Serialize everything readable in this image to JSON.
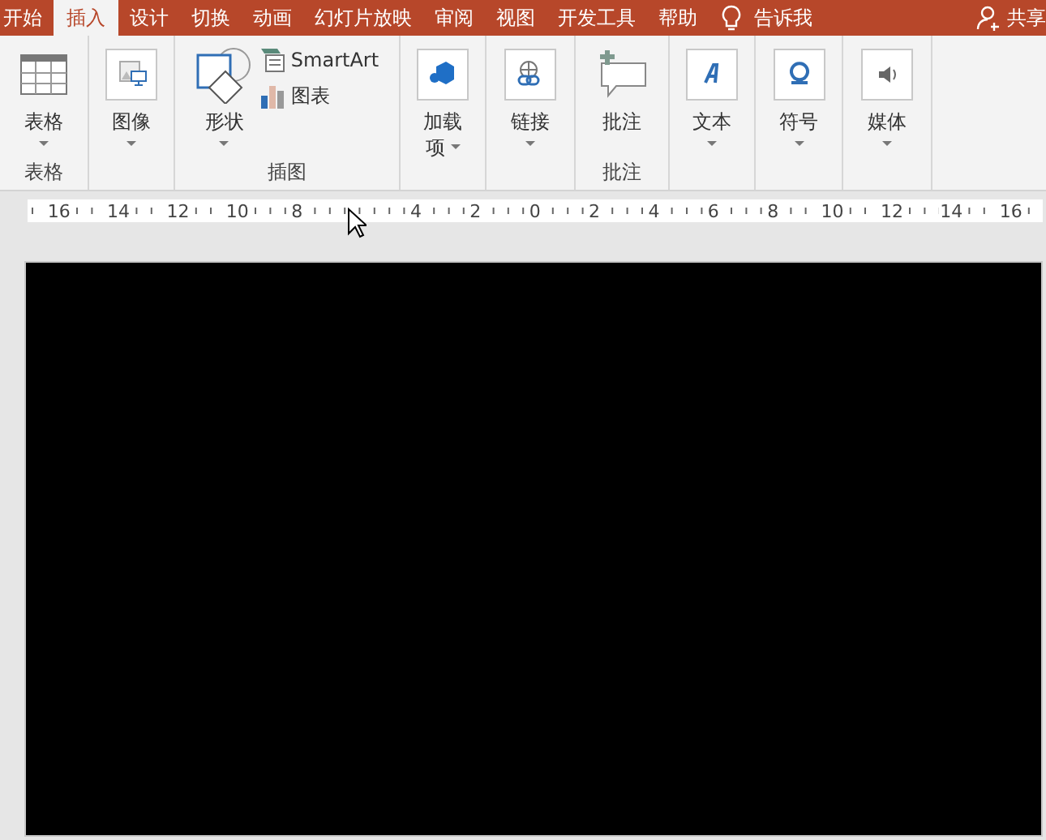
{
  "tabs": [
    {
      "label": "开始",
      "selected": false
    },
    {
      "label": "插入",
      "selected": true
    },
    {
      "label": "设计",
      "selected": false
    },
    {
      "label": "切换",
      "selected": false
    },
    {
      "label": "动画",
      "selected": false
    },
    {
      "label": "幻灯片放映",
      "selected": false
    },
    {
      "label": "审阅",
      "selected": false
    },
    {
      "label": "视图",
      "selected": false
    },
    {
      "label": "开发工具",
      "selected": false
    },
    {
      "label": "帮助",
      "selected": false
    }
  ],
  "tell_me": "告诉我",
  "share": "共享",
  "ribbon_groups": [
    {
      "label": "表格",
      "buttons": [
        {
          "kind": "table",
          "label": "表格",
          "dropdown": true
        }
      ]
    },
    {
      "buttons": [
        {
          "kind": "image",
          "label": "图像",
          "dropdown": true
        }
      ]
    },
    {
      "label": "插图",
      "buttons": [
        {
          "kind": "shapes",
          "label": "形状",
          "dropdown": true
        }
      ],
      "small_buttons": [
        {
          "kind": "smartart",
          "label": "SmartArt"
        },
        {
          "kind": "chart",
          "label": "图表"
        }
      ]
    },
    {
      "buttons": [
        {
          "kind": "addin",
          "label": "加载",
          "label2": "项",
          "dropdown": true
        }
      ]
    },
    {
      "buttons": [
        {
          "kind": "link",
          "label": "链接",
          "dropdown": true
        }
      ]
    },
    {
      "label": "批注",
      "buttons": [
        {
          "kind": "comment",
          "label": "批注",
          "dropdown": false
        }
      ]
    },
    {
      "buttons": [
        {
          "kind": "text",
          "label": "文本",
          "dropdown": true
        }
      ]
    },
    {
      "buttons": [
        {
          "kind": "symbol",
          "label": "符号",
          "dropdown": true
        }
      ]
    },
    {
      "buttons": [
        {
          "kind": "media",
          "label": "媒体",
          "dropdown": true
        }
      ]
    }
  ],
  "ruler": [
    {
      "text": "16"
    },
    {
      "text": "14"
    },
    {
      "text": "12"
    },
    {
      "text": "10"
    },
    {
      "text": "8"
    },
    {
      "kind": "cursor"
    },
    {
      "text": "4"
    },
    {
      "text": "2"
    },
    {
      "text": "0"
    },
    {
      "text": "2"
    },
    {
      "text": "4"
    },
    {
      "text": "6"
    },
    {
      "text": "8"
    },
    {
      "text": "10"
    },
    {
      "text": "12"
    },
    {
      "text": "14"
    },
    {
      "text": "16"
    }
  ]
}
